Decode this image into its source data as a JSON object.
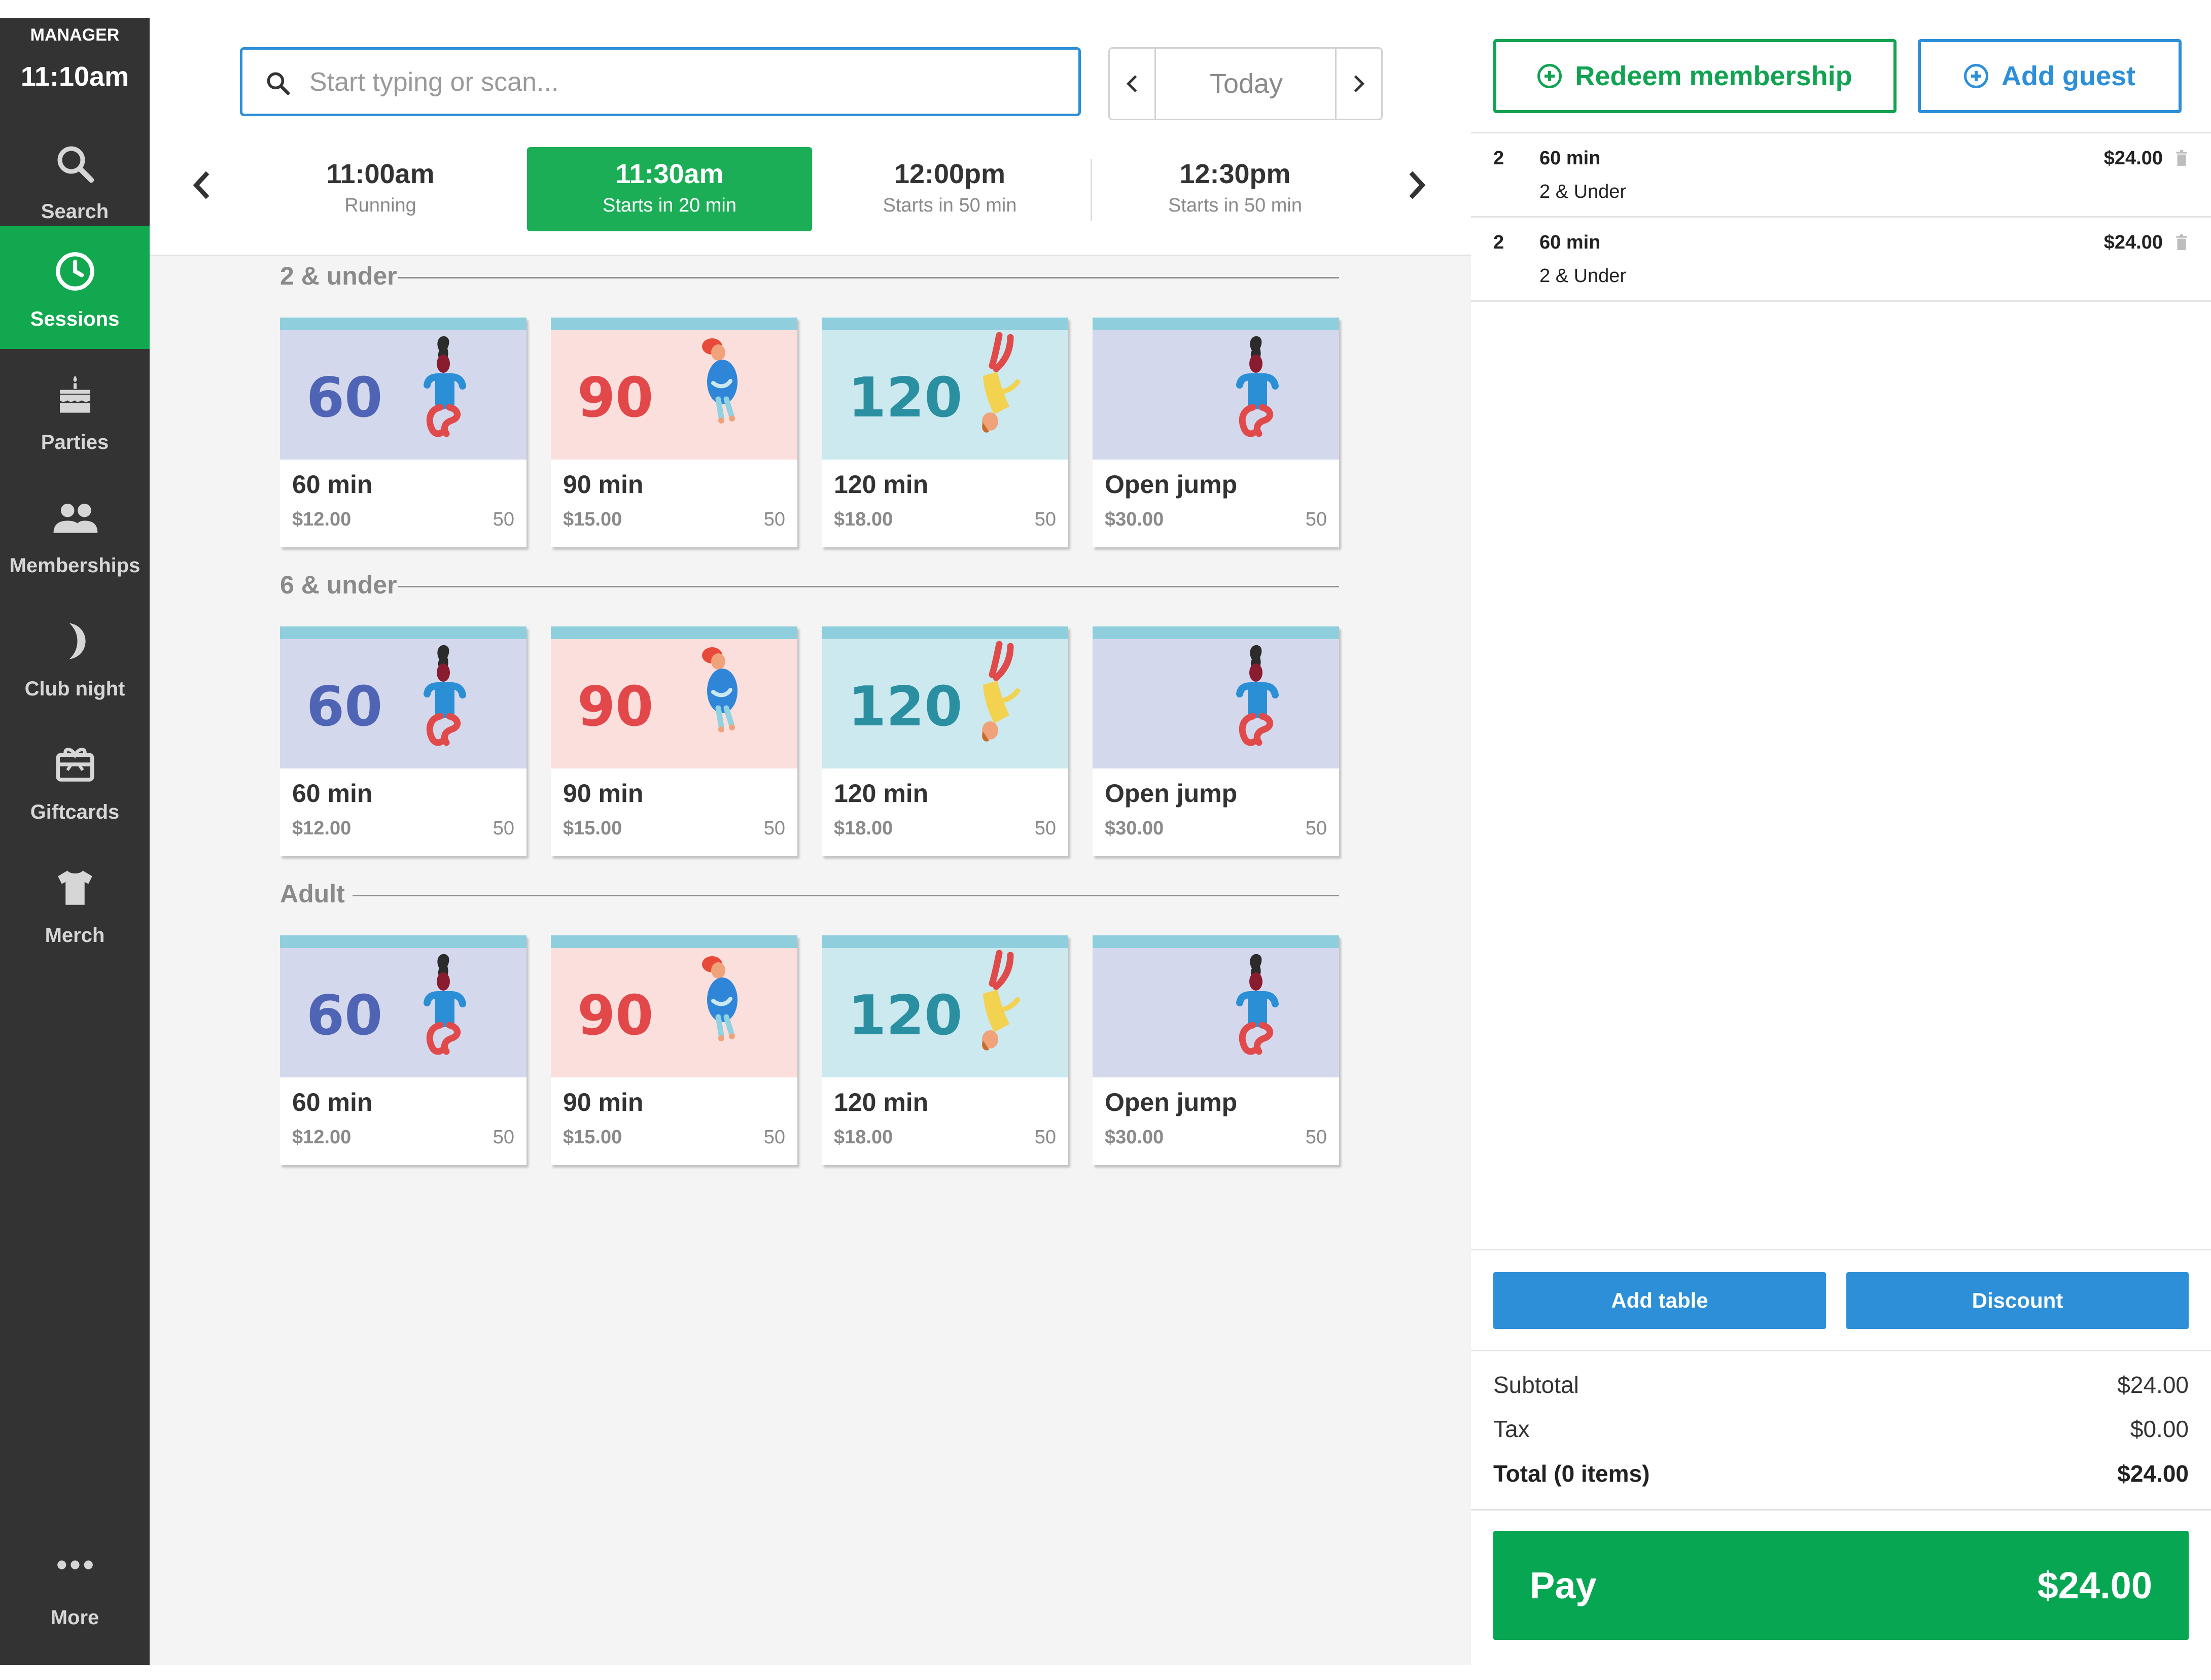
{
  "sidebar": {
    "role": "MANAGER",
    "time": "11:10am",
    "items": [
      {
        "label": "Search",
        "icon": "search-icon"
      },
      {
        "label": "Sessions",
        "icon": "clock-icon"
      },
      {
        "label": "Parties",
        "icon": "cake-icon"
      },
      {
        "label": "Memberships",
        "icon": "people-icon"
      },
      {
        "label": "Club night",
        "icon": "moon-icon"
      },
      {
        "label": "Giftcards",
        "icon": "gift-icon"
      },
      {
        "label": "Merch",
        "icon": "tshirt-icon"
      }
    ],
    "more": {
      "label": "More",
      "icon": "more-dots-icon"
    }
  },
  "search": {
    "placeholder": "Start typing or scan...",
    "value": ""
  },
  "date_nav": {
    "label": "Today"
  },
  "timeslots": [
    {
      "time": "11:00am",
      "status": "Running",
      "selected": false
    },
    {
      "time": "11:30am",
      "status": "Starts in 20 min",
      "selected": true
    },
    {
      "time": "12:00pm",
      "status": "Starts in 50 min",
      "selected": false
    },
    {
      "time": "12:30pm",
      "status": "Starts in 50 min",
      "selected": false
    }
  ],
  "groups": [
    {
      "title": "2 & under",
      "products": [
        {
          "name": "60 min",
          "price": "$12.00",
          "capacity": "50",
          "badge": "60"
        },
        {
          "name": "90 min",
          "price": "$15.00",
          "capacity": "50",
          "badge": "90"
        },
        {
          "name": "120 min",
          "price": "$18.00",
          "capacity": "50",
          "badge": "120"
        },
        {
          "name": "Open jump",
          "price": "$30.00",
          "capacity": "50",
          "badge": ""
        }
      ]
    },
    {
      "title": "6 & under",
      "products": [
        {
          "name": "60 min",
          "price": "$12.00",
          "capacity": "50",
          "badge": "60"
        },
        {
          "name": "90 min",
          "price": "$15.00",
          "capacity": "50",
          "badge": "90"
        },
        {
          "name": "120 min",
          "price": "$18.00",
          "capacity": "50",
          "badge": "120"
        },
        {
          "name": "Open jump",
          "price": "$30.00",
          "capacity": "50",
          "badge": ""
        }
      ]
    },
    {
      "title": "Adult",
      "products": [
        {
          "name": "60 min",
          "price": "$12.00",
          "capacity": "50",
          "badge": "60"
        },
        {
          "name": "90 min",
          "price": "$15.00",
          "capacity": "50",
          "badge": "90"
        },
        {
          "name": "120 min",
          "price": "$18.00",
          "capacity": "50",
          "badge": "120"
        },
        {
          "name": "Open jump",
          "price": "$30.00",
          "capacity": "50",
          "badge": ""
        }
      ]
    }
  ],
  "cart": {
    "redeem_label": "Redeem membership",
    "add_guest_label": "Add guest",
    "lines": [
      {
        "qty": "2",
        "name": "60 min",
        "group": "2 & Under",
        "price": "$24.00"
      },
      {
        "qty": "2",
        "name": "60 min",
        "group": "2 & Under",
        "price": "$24.00"
      }
    ],
    "add_table_label": "Add table",
    "discount_label": "Discount",
    "subtotal_label": "Subtotal",
    "subtotal": "$24.00",
    "tax_label": "Tax",
    "tax": "$0.00",
    "total_label": "Total (0 items)",
    "total": "$24.00",
    "pay_label": "Pay",
    "pay_amount": "$24.00"
  },
  "colors": {
    "sidebar_bg": "#333333",
    "accent_green": "#12a84f",
    "accent_blue": "#2d8fd8",
    "pay_green": "#06a653"
  }
}
